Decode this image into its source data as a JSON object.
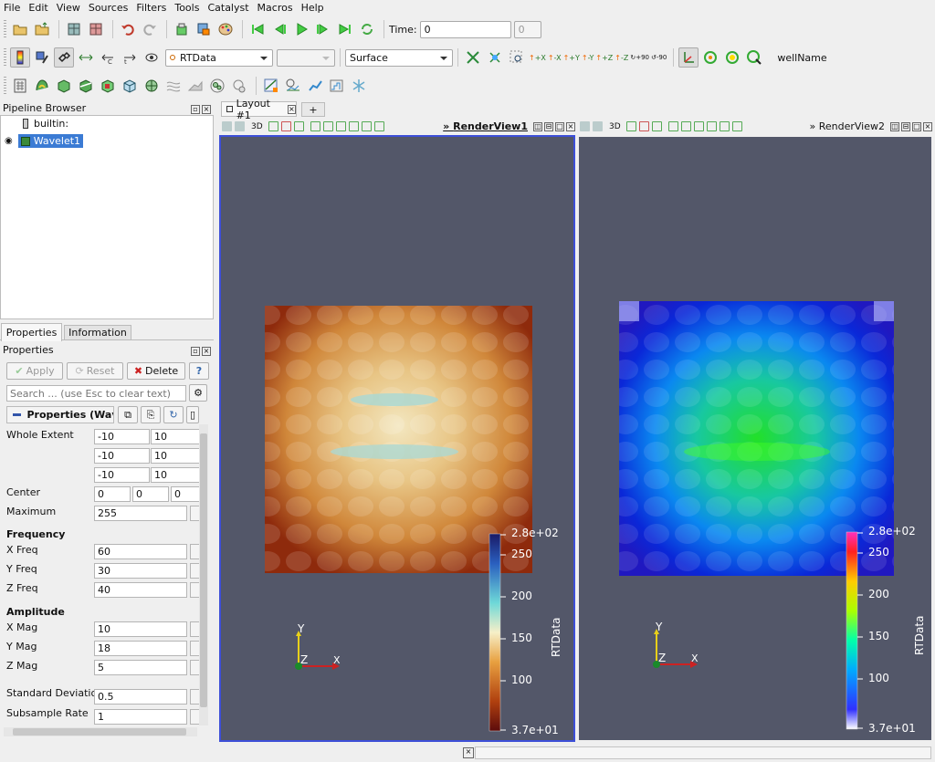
{
  "menu": [
    "File",
    "Edit",
    "View",
    "Sources",
    "Filters",
    "Tools",
    "Catalyst",
    "Macros",
    "Help"
  ],
  "toolbar": {
    "time_label": "Time:",
    "time_value": "0",
    "time_index": "0",
    "array_name": "RTData",
    "component_value": "",
    "representation": "Surface",
    "well_name": "wellName",
    "camera": [
      "+X",
      "-X",
      "+Y",
      "-Y",
      "+Z",
      "-Z"
    ],
    "rot_plus": "+90",
    "rot_minus": "-90"
  },
  "pipeline": {
    "title": "Pipeline Browser",
    "server": "builtin:",
    "source": "Wavelet1"
  },
  "tabs": {
    "properties": "Properties",
    "information": "Information"
  },
  "properties_panel": {
    "title": "Properties",
    "apply": "Apply",
    "reset": "Reset",
    "delete": "Delete",
    "help": "?",
    "search_placeholder": "Search ... (use Esc to clear text)",
    "section_title": "Properties (Wav",
    "whole_extent_label": "Whole Extent",
    "whole_extent": [
      [
        "-10",
        "10"
      ],
      [
        "-10",
        "10"
      ],
      [
        "-10",
        "10"
      ]
    ],
    "center_label": "Center",
    "center": [
      "0",
      "0",
      "0"
    ],
    "maximum_label": "Maximum",
    "maximum": "255",
    "frequency_header": "Frequency",
    "x_freq_label": "X Freq",
    "x_freq": "60",
    "y_freq_label": "Y Freq",
    "y_freq": "30",
    "z_freq_label": "Z Freq",
    "z_freq": "40",
    "amplitude_header": "Amplitude",
    "x_mag_label": "X Mag",
    "x_mag": "10",
    "y_mag_label": "Y Mag",
    "y_mag": "18",
    "z_mag_label": "Z Mag",
    "z_mag": "5",
    "std_dev_label": "Standard Deviation",
    "std_dev": "0.5",
    "subsample_label": "Subsample Rate",
    "subsample": "1"
  },
  "layout_tab": {
    "label": "Layout #1",
    "add": "+"
  },
  "views": [
    {
      "name": "RenderView1",
      "mode": "3D",
      "colorbar": {
        "title": "RTData",
        "labels": [
          "2.8e+02",
          "250",
          "200",
          "150",
          "100",
          "3.7e+01"
        ]
      },
      "axes": {
        "y": "Y",
        "z": "Z",
        "x": "X"
      }
    },
    {
      "name": "RenderView2",
      "mode": "3D",
      "colorbar": {
        "title": "RTData",
        "labels": [
          "2.8e+02",
          "250",
          "200",
          "150",
          "100",
          "3.7e+01"
        ]
      },
      "axes": {
        "y": "Y",
        "z": "Z",
        "x": "X"
      }
    }
  ],
  "colors": {
    "view_bg": "#535769",
    "accent": "#3d6fcf",
    "selection": "#3b7bd4"
  }
}
